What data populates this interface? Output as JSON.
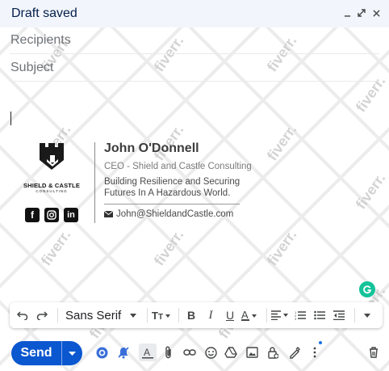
{
  "header": {
    "title": "Draft saved"
  },
  "fields": {
    "recipients_placeholder": "Recipients",
    "subject_placeholder": "Subject"
  },
  "signature": {
    "brand": "SHIELD & CASTLE",
    "brand_sub": "CONSULTING",
    "name": "John O'Donnell",
    "title": "CEO - Shield and Castle Consulting",
    "tagline": "Building Resilience and Securing Futures In A Hazardous World.",
    "email": "John@ShieldandCastle.com",
    "socials": [
      "facebook-icon",
      "instagram-icon",
      "linkedin-icon"
    ]
  },
  "toolbar": {
    "font": "Sans Serif"
  },
  "send": {
    "label": "Send"
  },
  "watermark": "fiverr.",
  "colors": {
    "send_bg": "#0b57d0",
    "header_bg": "#f2f6fc",
    "grammarly": "#15c39a"
  }
}
